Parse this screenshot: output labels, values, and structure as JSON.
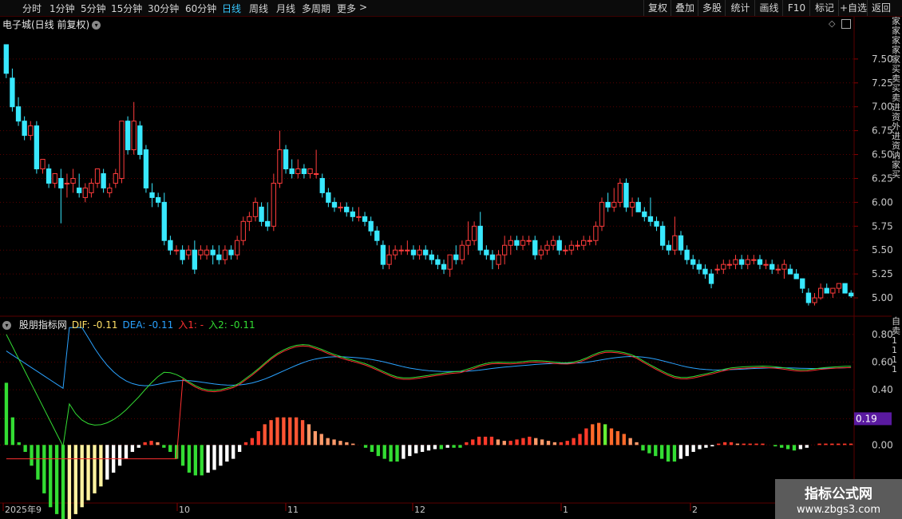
{
  "toolbar": {
    "periods": [
      "分时",
      "1分钟",
      "5分钟",
      "15分钟",
      "30分钟",
      "60分钟",
      "日线",
      "周线",
      "月线",
      "多周期",
      "更多"
    ],
    "active_period": "日线",
    "more_arrow": ">",
    "right_buttons": [
      "复权",
      "叠加",
      "多股",
      "统计",
      "画线",
      "F10",
      "标记",
      "+自选",
      "返回"
    ]
  },
  "chart": {
    "title": "电子城(日线 前复权)",
    "dropdown_icon": "chevron-down-icon",
    "price_ticks": [
      "7.50",
      "7.25",
      "7.00",
      "6.75",
      "6.50",
      "6.25",
      "6.00",
      "5.75",
      "5.50",
      "5.25",
      "5.00"
    ],
    "colors": {
      "up": "#ff3c3c",
      "down": "#38e8ff",
      "grid": "#5a0000",
      "axis_text": "#c8c8c8"
    }
  },
  "indicator": {
    "name": "股朋指标网",
    "dif_label": "DIF: -0.11",
    "dea_label": "DEA: -0.11",
    "in1_label": "入1: -",
    "in2_label": "入2: -0.11",
    "ticks": [
      "0.80",
      "0.60",
      "0.40",
      "0.19",
      "0.00"
    ],
    "current_value": "0.19",
    "colors": {
      "dif": "#ffe066",
      "dea": "#2aa2ff",
      "in1": "#ff3030",
      "in2": "#33dd33",
      "badge": "#5a1aa0"
    }
  },
  "time_axis": {
    "labels": [
      "2025年9",
      "10",
      "11",
      "12",
      "1",
      "2"
    ]
  },
  "right_strip": {
    "text": "家家家家家买卖买卖进资外进资讷家买",
    "indicator_text": "自卖1111"
  },
  "watermark": {
    "line1": "指标公式网",
    "line2": "www.zbgs3.com"
  },
  "chart_data": {
    "type": "candlestick",
    "title": "电子城(日线 前复权)",
    "ylim": [
      4.9,
      7.8
    ],
    "candles_ohlc": [
      [
        7.65,
        7.65,
        7.3,
        7.35
      ],
      [
        7.3,
        7.4,
        6.95,
        7.0
      ],
      [
        7.0,
        7.1,
        6.8,
        6.85
      ],
      [
        6.85,
        6.9,
        6.65,
        6.7
      ],
      [
        6.7,
        6.85,
        6.65,
        6.8
      ],
      [
        6.8,
        6.85,
        6.3,
        6.35
      ],
      [
        6.35,
        6.45,
        6.3,
        6.45
      ],
      [
        6.35,
        6.4,
        6.15,
        6.2
      ],
      [
        6.2,
        6.3,
        6.15,
        6.3
      ],
      [
        6.25,
        6.35,
        5.78,
        6.15
      ],
      [
        6.2,
        6.3,
        6.05,
        6.2
      ],
      [
        6.2,
        6.35,
        6.1,
        6.25
      ],
      [
        6.15,
        6.3,
        6.05,
        6.1
      ],
      [
        6.05,
        6.2,
        6.0,
        6.15
      ],
      [
        6.1,
        6.25,
        6.05,
        6.2
      ],
      [
        6.2,
        6.35,
        6.15,
        6.35
      ],
      [
        6.3,
        6.35,
        6.1,
        6.15
      ],
      [
        6.1,
        6.2,
        6.05,
        6.15
      ],
      [
        6.2,
        6.35,
        6.15,
        6.3
      ],
      [
        6.25,
        6.85,
        6.2,
        6.85
      ],
      [
        6.85,
        6.9,
        6.5,
        6.55
      ],
      [
        6.55,
        7.05,
        6.5,
        6.85
      ],
      [
        6.8,
        6.85,
        6.45,
        6.5
      ],
      [
        6.55,
        6.6,
        6.1,
        6.15
      ],
      [
        6.1,
        6.2,
        5.95,
        6.05
      ],
      [
        6.05,
        6.1,
        5.95,
        6.0
      ],
      [
        6.0,
        6.1,
        5.55,
        5.6
      ],
      [
        5.6,
        5.65,
        5.45,
        5.5
      ],
      [
        5.5,
        5.55,
        5.45,
        5.5
      ],
      [
        5.5,
        5.55,
        5.35,
        5.4
      ],
      [
        5.45,
        5.55,
        5.4,
        5.5
      ],
      [
        5.5,
        5.6,
        5.25,
        5.3
      ],
      [
        5.45,
        5.55,
        5.4,
        5.5
      ],
      [
        5.45,
        5.55,
        5.4,
        5.5
      ],
      [
        5.5,
        5.55,
        5.35,
        5.45
      ],
      [
        5.45,
        5.55,
        5.35,
        5.4
      ],
      [
        5.4,
        5.55,
        5.35,
        5.5
      ],
      [
        5.5,
        5.55,
        5.4,
        5.45
      ],
      [
        5.45,
        5.65,
        5.4,
        5.6
      ],
      [
        5.6,
        5.85,
        5.55,
        5.8
      ],
      [
        5.8,
        5.9,
        5.7,
        5.85
      ],
      [
        5.85,
        6.05,
        5.8,
        6.0
      ],
      [
        5.95,
        6.0,
        5.75,
        5.8
      ],
      [
        5.8,
        6.0,
        5.7,
        5.75
      ],
      [
        5.75,
        6.3,
        5.7,
        6.2
      ],
      [
        6.2,
        6.75,
        6.15,
        6.55
      ],
      [
        6.55,
        6.6,
        6.3,
        6.35
      ],
      [
        6.35,
        6.45,
        6.25,
        6.3
      ],
      [
        6.3,
        6.45,
        6.25,
        6.35
      ],
      [
        6.35,
        6.4,
        6.25,
        6.3
      ],
      [
        6.3,
        6.35,
        6.25,
        6.35
      ],
      [
        6.3,
        6.55,
        6.25,
        6.3
      ],
      [
        6.25,
        6.3,
        6.05,
        6.1
      ],
      [
        6.1,
        6.15,
        5.95,
        6.0
      ],
      [
        6.0,
        6.05,
        5.9,
        5.95
      ],
      [
        5.95,
        6.0,
        5.9,
        5.95
      ],
      [
        5.95,
        6.0,
        5.85,
        5.9
      ],
      [
        5.9,
        5.95,
        5.8,
        5.85
      ],
      [
        5.85,
        5.95,
        5.8,
        5.85
      ],
      [
        5.85,
        5.9,
        5.75,
        5.8
      ],
      [
        5.8,
        5.85,
        5.65,
        5.7
      ],
      [
        5.7,
        5.75,
        5.55,
        5.6
      ],
      [
        5.55,
        5.6,
        5.3,
        5.35
      ],
      [
        5.35,
        5.55,
        5.3,
        5.45
      ],
      [
        5.45,
        5.55,
        5.4,
        5.5
      ],
      [
        5.5,
        5.55,
        5.45,
        5.5
      ],
      [
        5.5,
        5.6,
        5.45,
        5.5
      ],
      [
        5.5,
        5.55,
        5.4,
        5.45
      ],
      [
        5.45,
        5.55,
        5.4,
        5.5
      ],
      [
        5.5,
        5.55,
        5.4,
        5.45
      ],
      [
        5.45,
        5.5,
        5.35,
        5.4
      ],
      [
        5.4,
        5.45,
        5.3,
        5.35
      ],
      [
        5.35,
        5.4,
        5.25,
        5.3
      ],
      [
        5.3,
        5.45,
        5.22,
        5.45
      ],
      [
        5.45,
        5.55,
        5.35,
        5.4
      ],
      [
        5.4,
        5.6,
        5.35,
        5.55
      ],
      [
        5.55,
        5.8,
        5.45,
        5.6
      ],
      [
        5.6,
        5.8,
        5.55,
        5.75
      ],
      [
        5.75,
        5.9,
        5.45,
        5.5
      ],
      [
        5.5,
        5.55,
        5.4,
        5.45
      ],
      [
        5.45,
        5.5,
        5.3,
        5.4
      ],
      [
        5.35,
        5.5,
        5.3,
        5.45
      ],
      [
        5.45,
        5.65,
        5.35,
        5.55
      ],
      [
        5.55,
        5.65,
        5.45,
        5.6
      ],
      [
        5.6,
        5.65,
        5.5,
        5.55
      ],
      [
        5.55,
        5.65,
        5.5,
        5.6
      ],
      [
        5.6,
        5.65,
        5.55,
        5.6
      ],
      [
        5.6,
        5.65,
        5.4,
        5.45
      ],
      [
        5.45,
        5.55,
        5.4,
        5.5
      ],
      [
        5.5,
        5.6,
        5.45,
        5.55
      ],
      [
        5.55,
        5.65,
        5.5,
        5.6
      ],
      [
        5.6,
        5.65,
        5.45,
        5.5
      ],
      [
        5.5,
        5.55,
        5.45,
        5.5
      ],
      [
        5.5,
        5.6,
        5.45,
        5.55
      ],
      [
        5.55,
        5.6,
        5.5,
        5.55
      ],
      [
        5.55,
        5.65,
        5.5,
        5.6
      ],
      [
        5.6,
        5.65,
        5.55,
        5.6
      ],
      [
        5.6,
        5.8,
        5.55,
        5.75
      ],
      [
        5.75,
        6.05,
        5.7,
        6.0
      ],
      [
        6.0,
        6.1,
        5.9,
        5.95
      ],
      [
        5.95,
        6.15,
        5.9,
        6.0
      ],
      [
        6.0,
        6.25,
        5.95,
        6.2
      ],
      [
        6.2,
        6.25,
        5.9,
        5.95
      ],
      [
        5.95,
        6.05,
        5.85,
        6.0
      ],
      [
        6.0,
        6.05,
        5.9,
        5.9
      ],
      [
        5.9,
        5.95,
        5.8,
        5.85
      ],
      [
        5.85,
        6.05,
        5.75,
        5.8
      ],
      [
        5.8,
        5.85,
        5.7,
        5.75
      ],
      [
        5.75,
        5.8,
        5.5,
        5.55
      ],
      [
        5.55,
        5.6,
        5.45,
        5.5
      ],
      [
        5.5,
        5.85,
        5.45,
        5.65
      ],
      [
        5.65,
        5.7,
        5.45,
        5.5
      ],
      [
        5.5,
        5.55,
        5.35,
        5.4
      ],
      [
        5.4,
        5.45,
        5.3,
        5.35
      ],
      [
        5.35,
        5.4,
        5.25,
        5.3
      ],
      [
        5.3,
        5.35,
        5.2,
        5.25
      ],
      [
        5.25,
        5.3,
        5.1,
        5.15
      ],
      [
        5.3,
        5.35,
        5.25,
        5.3
      ],
      [
        5.3,
        5.4,
        5.25,
        5.35
      ],
      [
        5.35,
        5.4,
        5.3,
        5.35
      ],
      [
        5.35,
        5.45,
        5.3,
        5.4
      ],
      [
        5.4,
        5.45,
        5.3,
        5.35
      ],
      [
        5.35,
        5.45,
        5.3,
        5.4
      ],
      [
        5.4,
        5.45,
        5.35,
        5.4
      ],
      [
        5.4,
        5.45,
        5.3,
        5.35
      ],
      [
        5.35,
        5.4,
        5.3,
        5.35
      ],
      [
        5.35,
        5.4,
        5.25,
        5.3
      ],
      [
        5.3,
        5.35,
        5.25,
        5.3
      ],
      [
        5.3,
        5.4,
        5.2,
        5.35
      ],
      [
        5.3,
        5.35,
        5.25,
        5.25
      ],
      [
        5.25,
        5.3,
        5.2,
        5.2
      ],
      [
        5.2,
        5.15,
        5.05,
        5.1
      ],
      [
        5.05,
        5.1,
        4.92,
        4.95
      ],
      [
        4.95,
        5.05,
        4.92,
        5.0
      ],
      [
        5.0,
        5.15,
        4.98,
        5.1
      ],
      [
        5.1,
        5.15,
        5.05,
        5.05
      ],
      [
        5.05,
        5.1,
        5.0,
        5.1
      ],
      [
        5.1,
        5.15,
        5.05,
        5.15
      ],
      [
        5.15,
        5.15,
        5.05,
        5.05
      ],
      [
        5.05,
        5.08,
        5.0,
        5.02
      ]
    ],
    "macd_hist": [
      0.45,
      0.2,
      0.02,
      -0.05,
      -0.15,
      -0.25,
      -0.35,
      -0.45,
      -0.5,
      -0.55,
      -0.55,
      -0.5,
      -0.45,
      -0.4,
      -0.35,
      -0.3,
      -0.25,
      -0.2,
      -0.15,
      -0.1,
      -0.05,
      -0.02,
      0.02,
      0.03,
      0.02,
      -0.02,
      -0.05,
      -0.1,
      -0.15,
      -0.2,
      -0.22,
      -0.22,
      -0.2,
      -0.18,
      -0.15,
      -0.12,
      -0.1,
      -0.05,
      0.02,
      0.05,
      0.1,
      0.15,
      0.18,
      0.2,
      0.2,
      0.2,
      0.2,
      0.18,
      0.15,
      0.1,
      0.08,
      0.05,
      0.04,
      0.03,
      0.02,
      0.01,
      0.0,
      -0.02,
      -0.05,
      -0.08,
      -0.1,
      -0.12,
      -0.12,
      -0.1,
      -0.08,
      -0.06,
      -0.05,
      -0.04,
      -0.03,
      -0.03,
      -0.02,
      -0.02,
      -0.02,
      0.02,
      0.04,
      0.06,
      0.06,
      0.06,
      0.04,
      0.03,
      0.03,
      0.04,
      0.05,
      0.06,
      0.05,
      0.04,
      0.03,
      0.02,
      0.02,
      0.03,
      0.05,
      0.08,
      0.12,
      0.15,
      0.16,
      0.15,
      0.12,
      0.1,
      0.08,
      0.05,
      0.02,
      -0.04,
      -0.06,
      -0.08,
      -0.1,
      -0.12,
      -0.12,
      -0.1,
      -0.08,
      -0.05,
      -0.03,
      -0.02,
      -0.01,
      0.01,
      0.02,
      0.02,
      0.01,
      0.01,
      0.01,
      0.01,
      0.01,
      0.0,
      -0.01,
      -0.02,
      -0.03,
      -0.04,
      -0.03,
      -0.02,
      0.0,
      0.01,
      0.01,
      0.01,
      0.01,
      0.01,
      0.01
    ]
  }
}
